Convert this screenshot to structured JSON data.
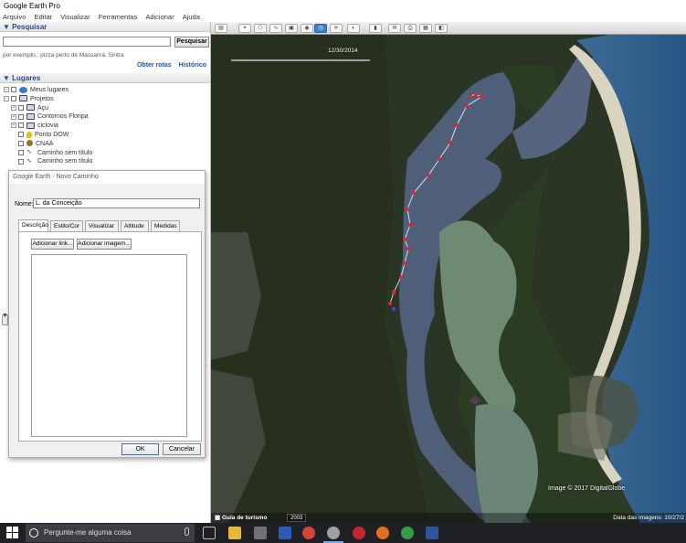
{
  "window": {
    "title": "Google Earth Pro"
  },
  "menu": [
    "Arquivo",
    "Editar",
    "Visualizar",
    "Ferramentas",
    "Adicionar",
    "Ajuda"
  ],
  "search": {
    "header": "▼ Pesquisar",
    "button": "Pesquisar",
    "hint": "por exemplo,: pizza perto de Massamá, Sintra",
    "links": [
      "Obter rotas",
      "Histórico"
    ]
  },
  "places": {
    "header": "▼ Lugares",
    "items": [
      {
        "label": "Meus lugares",
        "icon": "globe-icon"
      },
      {
        "label": "Projetos",
        "icon": "folder-icon"
      },
      {
        "label": "Açu",
        "icon": "folder-icon"
      },
      {
        "label": "Contornos Floripa",
        "icon": "folder-icon"
      },
      {
        "label": "ciclovia",
        "icon": "folder-icon"
      },
      {
        "label": "Ponto DOW",
        "icon": "pin-icon"
      },
      {
        "label": "CNAA",
        "icon": "circle-icon"
      },
      {
        "label": "Caminho sem título",
        "icon": "path-icon"
      },
      {
        "label": "Caminho sem título",
        "icon": "path-icon"
      }
    ]
  },
  "dialog": {
    "title": "Google Earth - Novo Caminho",
    "name_label": "Nome:",
    "name_value": "L. da Conceição",
    "tabs": [
      "Descrição",
      "Estilo/Cor",
      "Visualizar",
      "Altitude",
      "Medidas"
    ],
    "add_link": "Adicionar link...",
    "add_image": "Adicionar imagem...",
    "ok": "OK",
    "cancel": "Cancelar"
  },
  "map": {
    "time_date": "12/30/2014",
    "tour_label": "Guia de turismo",
    "year_badge": "2003",
    "copyright": "Image © 2017 DigitalGlobe",
    "image_date": "Data das imagens: 10/27/2"
  },
  "taskbar": {
    "search_placeholder": "Pergunte-me alguma coisa"
  },
  "colors": {
    "accent": "#3f7ed0",
    "path_points": "#e8232a",
    "water": "#4f5f7a"
  }
}
